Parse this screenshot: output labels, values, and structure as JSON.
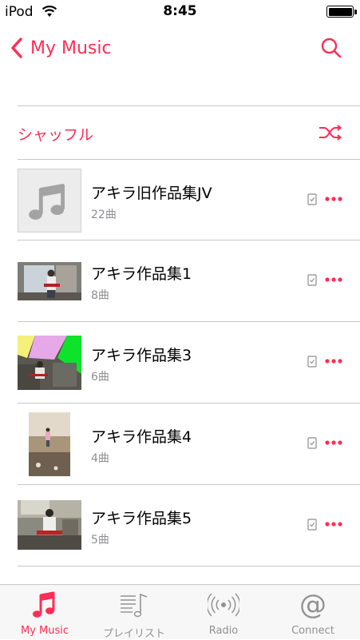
{
  "status_bar": {
    "carrier": "iPod",
    "time": "8:45"
  },
  "nav": {
    "back_label": "My Music"
  },
  "shuffle": {
    "label": "シャッフル"
  },
  "albums": [
    {
      "title": "アキラ旧作品集JV",
      "count": "22曲"
    },
    {
      "title": "アキラ作品集1",
      "count": "8曲"
    },
    {
      "title": "アキラ作品集3",
      "count": "6曲"
    },
    {
      "title": "アキラ作品集4",
      "count": "4曲"
    },
    {
      "title": "アキラ作品集5",
      "count": "5曲"
    }
  ],
  "tabs": [
    {
      "label": "My Music",
      "icon": "music-note-icon",
      "active": true
    },
    {
      "label": "プレイリスト",
      "icon": "playlist-icon",
      "active": false
    },
    {
      "label": "Radio",
      "icon": "radio-icon",
      "active": false
    },
    {
      "label": "Connect",
      "icon": "connect-icon",
      "active": false
    }
  ],
  "colors": {
    "accent": "#ff2d55",
    "secondary_text": "#8e8e93",
    "separator": "#c8c7cc"
  }
}
